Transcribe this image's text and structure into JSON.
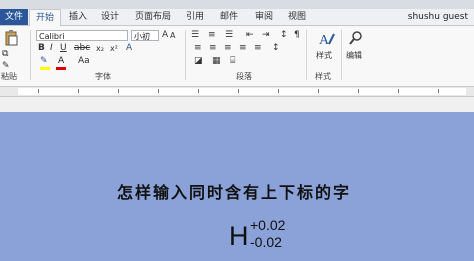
{
  "window": {
    "title": ""
  },
  "tabs": [
    "文件",
    "开始",
    "插入",
    "设计",
    "页面布局",
    "引用",
    "邮件",
    "审阅",
    "视图"
  ],
  "user": "shushu guest",
  "ribbon": {
    "paste_label": "粘贴",
    "font_name": "Calibri",
    "font_size": "小初",
    "group_font": "字体",
    "group_paragraph": "段落",
    "group_styles": "样式",
    "styles_label": "样式",
    "editing_label": "编辑"
  },
  "document": {
    "heading": "怎样输入同时含有上下标的字",
    "formula_base": "H",
    "formula_superscript": "+0.02",
    "formula_subscript": "-0.02"
  },
  "colors": {
    "file_tab": "#2b579a",
    "page_background": "#8aa2d8"
  }
}
